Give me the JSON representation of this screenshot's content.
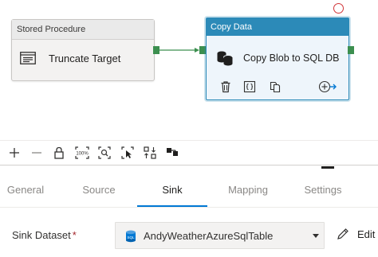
{
  "pipeline": {
    "stored_procedure": {
      "type_label": "Stored Procedure",
      "name": "Truncate Target",
      "icon": "stored-procedure-icon"
    },
    "copy_data": {
      "type_label": "Copy Data",
      "name": "Copy Blob to SQL DB",
      "icon": "database-icon",
      "actions": [
        "delete-icon",
        "code-icon",
        "clone-icon",
        "add-output-icon"
      ],
      "accent": "#2c8ab8"
    },
    "success_port_color": "#3c8f4f",
    "error_indicator_color": "#d13438"
  },
  "toolbar": {
    "buttons": [
      "zoom-in-icon",
      "zoom-out-icon",
      "lock-icon",
      "zoom-100-icon",
      "zoom-fit-icon",
      "select-icon",
      "auto-align-icon",
      "layout-icon"
    ],
    "zoom_100_label": "100%"
  },
  "tabs": {
    "items": [
      {
        "label": "General"
      },
      {
        "label": "Source"
      },
      {
        "label": "Sink"
      },
      {
        "label": "Mapping"
      },
      {
        "label": "Settings"
      }
    ],
    "active": "Sink",
    "active_color": "#0078d4"
  },
  "sink": {
    "dataset_label": "Sink Dataset",
    "required_marker": "*",
    "dataset_value": "AndyWeatherAzureSqlTable",
    "dataset_icon": "sql-icon",
    "edit_label": "Edit"
  }
}
